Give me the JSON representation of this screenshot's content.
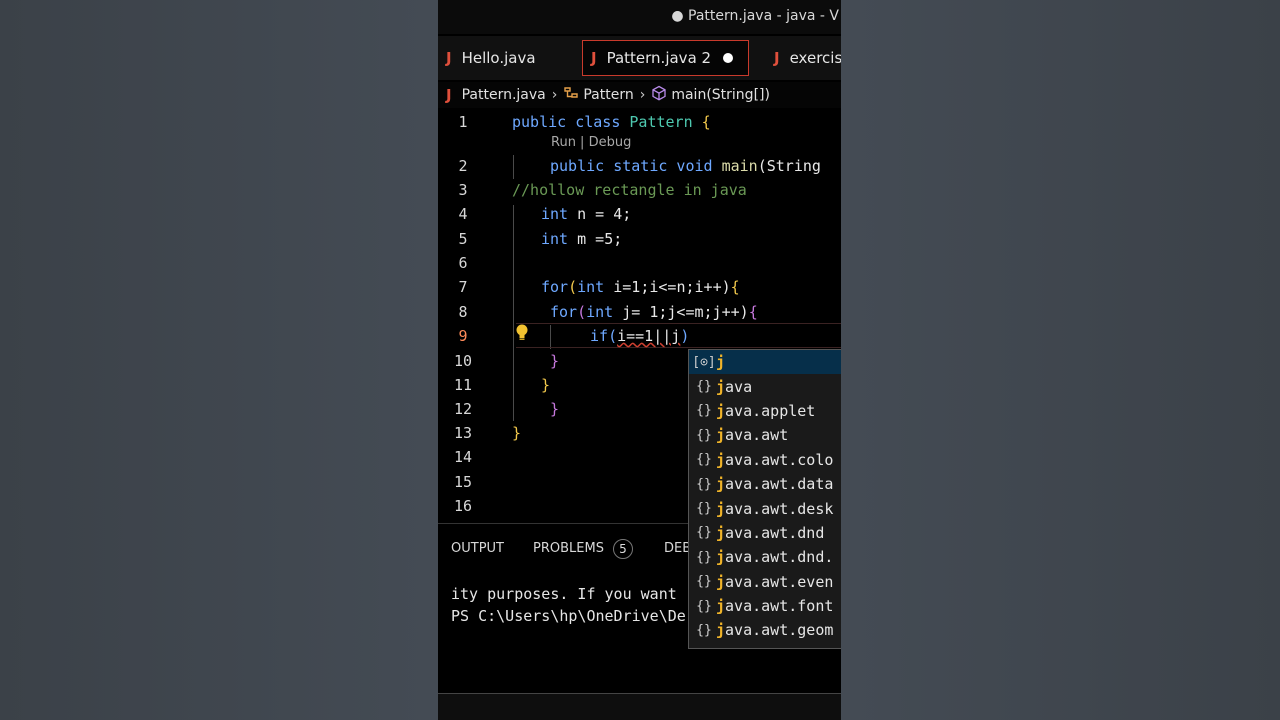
{
  "titlebar": {
    "title": "● Pattern.java - java - V"
  },
  "tabs": [
    {
      "label": "Hello.java",
      "icon": "java-file-icon"
    },
    {
      "label": "Pattern.java 2",
      "icon": "java-file-icon",
      "active": true,
      "modified": true
    },
    {
      "label": "exercis",
      "icon": "java-file-icon"
    }
  ],
  "breadcrumb": {
    "file": "Pattern.java",
    "class": "Pattern",
    "method": "main(String[])"
  },
  "editor": {
    "line_numbers": [
      "1",
      "2",
      "3",
      "4",
      "5",
      "6",
      "7",
      "8",
      "9",
      "10",
      "11",
      "12",
      "13",
      "14",
      "15",
      "16"
    ],
    "current_line": "9",
    "codelens": "Run | Debug",
    "lines": {
      "l1_kw": "public class ",
      "l1_cls": "Pattern",
      "l1_br": " {",
      "l2_kw": "public static void ",
      "l2_fn": "main",
      "l2_rest": "(String",
      "l3": "//hollow rectangle in java",
      "l4_kw": "int",
      "l4_rest": " n = 4;",
      "l5_kw": "int",
      "l5_rest": " m =5;",
      "l7_kw": "for",
      "l7_p": "(",
      "l7_kw2": "int",
      "l7_rest": " i=1;i<=n;i++)",
      "l7_br": "{",
      "l8_kw": "for",
      "l8_p": "(",
      "l8_kw2": "int",
      "l8_rest": " j= 1;j<=m;j++)",
      "l8_br": "{",
      "l9_kw": "if",
      "l9_p": "(",
      "l9_rest": "i==1||j",
      "l9_p2": ")",
      "l10": "}",
      "l11": "}",
      "l12": "}",
      "l13": "}"
    }
  },
  "suggestions": [
    {
      "icon": "variable-icon",
      "match": "j",
      "rest": ""
    },
    {
      "icon": "package-icon",
      "match": "j",
      "rest": "ava"
    },
    {
      "icon": "package-icon",
      "match": "j",
      "rest": "ava.applet"
    },
    {
      "icon": "package-icon",
      "match": "j",
      "rest": "ava.awt"
    },
    {
      "icon": "package-icon",
      "match": "j",
      "rest": "ava.awt.colo"
    },
    {
      "icon": "package-icon",
      "match": "j",
      "rest": "ava.awt.data"
    },
    {
      "icon": "package-icon",
      "match": "j",
      "rest": "ava.awt.desk"
    },
    {
      "icon": "package-icon",
      "match": "j",
      "rest": "ava.awt.dnd"
    },
    {
      "icon": "package-icon",
      "match": "j",
      "rest": "ava.awt.dnd."
    },
    {
      "icon": "package-icon",
      "match": "j",
      "rest": "ava.awt.even"
    },
    {
      "icon": "package-icon",
      "match": "j",
      "rest": "ava.awt.font"
    },
    {
      "icon": "package-icon",
      "match": "j",
      "rest": "ava.awt.geom"
    }
  ],
  "panel": {
    "tabs": [
      "OUTPUT",
      "PROBLEMS",
      "DEB"
    ],
    "problems_count": "5",
    "terminal": [
      "ity purposes. If you want",
      "PS C:\\Users\\hp\\OneDrive\\De"
    ]
  },
  "colors": {
    "accent": "#c93a2c",
    "java_icon": "#e0503c",
    "keyword": "#6ea8ff",
    "class": "#4ec9b0",
    "comment": "#6a9955",
    "match": "#f0b429"
  }
}
